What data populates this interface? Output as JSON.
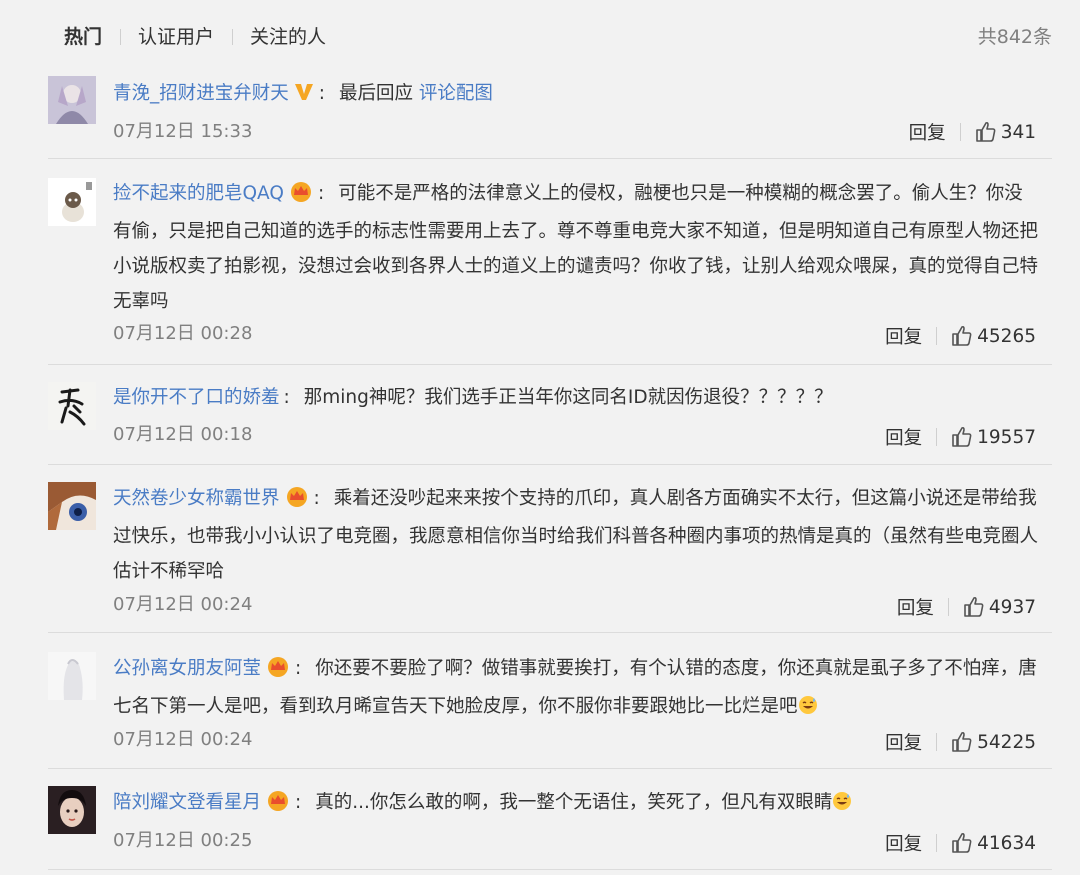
{
  "tabs": [
    {
      "label": "热门",
      "active": true
    },
    {
      "label": "认证用户",
      "active": false
    },
    {
      "label": "关注的人",
      "active": false
    }
  ],
  "total_count": "共842条",
  "reply_label": "回复",
  "colors": {
    "link": "#4a7cc5",
    "meta": "#808080",
    "badge_gold": "#f5a623",
    "badge_red": "#e94e2d"
  },
  "comments": [
    {
      "username": "青浼_招财进宝弁财天",
      "badge": "v-verified-icon",
      "content": "最后回应",
      "link_text": "评论配图",
      "time": "07月12日 15:33",
      "likes": "341"
    },
    {
      "username": "捡不起来的肥皂QAQ",
      "badge": "crown-vip-icon",
      "content": "可能不是严格的法律意义上的侵权，融梗也只是一种模糊的概念罢了。偷人生？你没有偷，只是把自己知道的选手的标志性需要用上去了。尊不尊重电竞大家不知道，但是明知道自己有原型人物还把小说版权卖了拍影视，没想过会收到各界人士的道义上的谴责吗？你收了钱，让别人给观众喂屎，真的觉得自己特无辜吗",
      "time": "07月12日 00:28",
      "likes": "45265"
    },
    {
      "username": "是你开不了口的娇羞",
      "badge": "",
      "content": "那ming神呢？我们选手正当年你这同名ID就因伤退役？？？？？",
      "time": "07月12日 00:18",
      "likes": "19557"
    },
    {
      "username": "天然卷少女称霸世界",
      "badge": "crown-vip-icon",
      "content": "乘着还没吵起来来按个支持的爪印，真人剧各方面确实不太行，但这篇小说还是带给我过快乐，也带我小小认识了电竞圈，我愿意相信你当时给我们科普各种圈内事项的热情是真的（虽然有些电竞圈人估计不稀罕哈",
      "time": "07月12日 00:24",
      "likes": "4937"
    },
    {
      "username": "公孙离女朋友阿莹",
      "badge": "crown-vip-icon",
      "content": "你还要不要脸了啊？做错事就要挨打，有个认错的态度，你还真就是虱子多了不怕痒，唐七名下第一人是吧，看到玖月晞宣告天下她脸皮厚，你不服你非要跟她比一比烂是吧",
      "emoji": "sweat-smile-emoji",
      "time": "07月12日 00:24",
      "likes": "54225"
    },
    {
      "username": "陪刘耀文登看星月",
      "badge": "crown-vip-icon",
      "content": "真的...你怎么敢的啊，我一整个无语住，笑死了，但凡有双眼睛",
      "emoji": "sweat-smile-emoji",
      "time": "07月12日 00:25",
      "likes": "41634"
    }
  ]
}
